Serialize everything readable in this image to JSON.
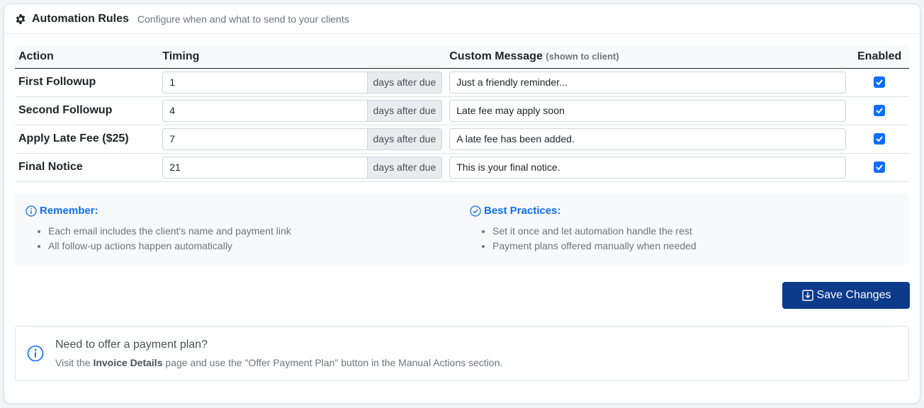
{
  "header": {
    "icon": "gear-icon",
    "title": "Automation Rules",
    "subtitle": "Configure when and what to send to your clients"
  },
  "table": {
    "columns": {
      "action": "Action",
      "timing": "Timing",
      "message": "Custom Message",
      "message_note": "(shown to client)",
      "enabled": "Enabled"
    },
    "addon_label": "days after due",
    "rows": [
      {
        "action": "First Followup",
        "days": "1",
        "message": "Just a friendly reminder...",
        "enabled": true
      },
      {
        "action": "Second Followup",
        "days": "4",
        "message": "Late fee may apply soon",
        "enabled": true
      },
      {
        "action": "Apply Late Fee ($25)",
        "days": "7",
        "message": "A late fee has been added.",
        "enabled": true
      },
      {
        "action": "Final Notice",
        "days": "21",
        "message": "This is your final notice.",
        "enabled": true
      }
    ]
  },
  "tips": {
    "remember": {
      "icon": "info-circle-icon",
      "title": "Remember:",
      "items": [
        "Each email includes the client's name and payment link",
        "All follow-up actions happen automatically"
      ]
    },
    "best": {
      "icon": "check-circle-icon",
      "title": "Best Practices:",
      "items": [
        "Set it once and let automation handle the rest",
        "Payment plans offered manually when needed"
      ]
    }
  },
  "save_button": {
    "icon": "save-download-icon",
    "label": "Save Changes"
  },
  "notice": {
    "icon": "info-circle-icon",
    "title": "Need to offer a payment plan?",
    "body_prefix": "Visit the ",
    "body_bold": "Invoice Details",
    "body_suffix": " page and use the \"Offer Payment Plan\" button in the Manual Actions section."
  },
  "colors": {
    "accent": "#0d6efd",
    "button": "#0d3b8a",
    "muted": "#6c757d"
  }
}
